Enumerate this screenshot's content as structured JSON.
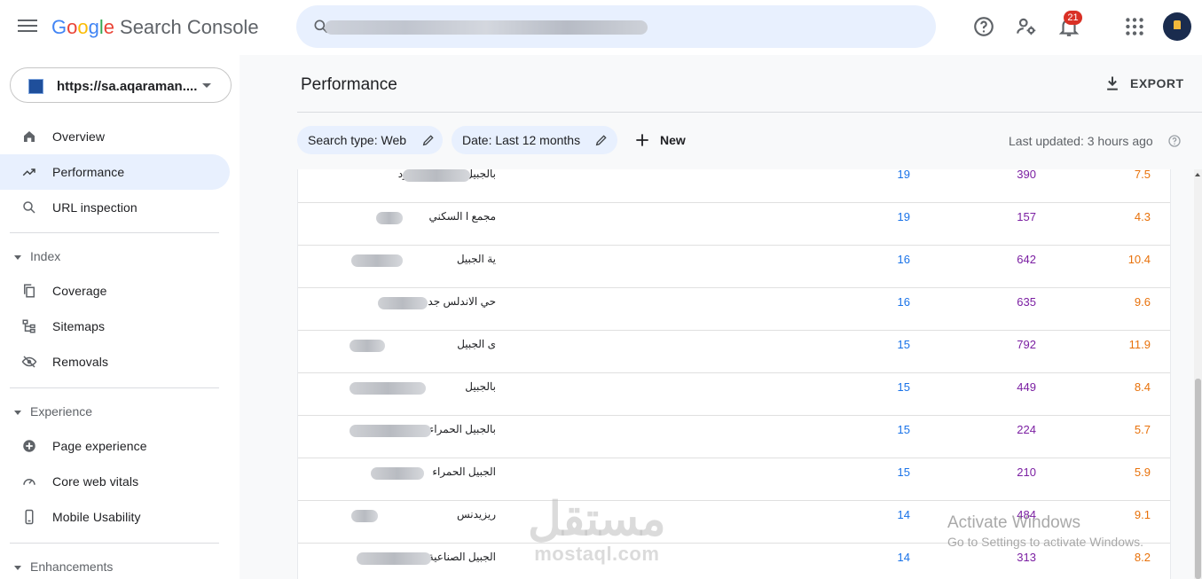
{
  "header": {
    "menu_icon": "hamburger-menu-icon",
    "logo": {
      "parts": [
        "G",
        "o",
        "o",
        "g",
        "l",
        "e"
      ],
      "product": "Search Console"
    },
    "search": {
      "placeholder": "",
      "icon": "search-icon"
    },
    "icons": {
      "help": "help-circle-icon",
      "settings": "manage-users-icon",
      "notifications": "bell-icon",
      "apps": "apps-grid-icon"
    },
    "notification_count": "21"
  },
  "sidebar": {
    "property": "https://sa.aqaraman....",
    "nav": [
      {
        "label": "Overview",
        "icon": "home-icon"
      },
      {
        "label": "Performance",
        "icon": "trending-up-icon",
        "active": true
      },
      {
        "label": "URL inspection",
        "icon": "search-icon"
      }
    ],
    "sections": [
      {
        "title": "Index",
        "items": [
          {
            "label": "Coverage",
            "icon": "copy-icon"
          },
          {
            "label": "Sitemaps",
            "icon": "sitemap-icon"
          },
          {
            "label": "Removals",
            "icon": "visibility-off-icon"
          }
        ]
      },
      {
        "title": "Experience",
        "items": [
          {
            "label": "Page experience",
            "icon": "plus-circle-icon"
          },
          {
            "label": "Core web vitals",
            "icon": "speed-gauge-icon"
          },
          {
            "label": "Mobile Usability",
            "icon": "phone-icon"
          }
        ]
      },
      {
        "title": "Enhancements",
        "items": []
      }
    ]
  },
  "main": {
    "title": "Performance",
    "export_label": "EXPORT",
    "filters": [
      {
        "label": "Search type: Web"
      },
      {
        "label": "Date: Last 12 months"
      }
    ],
    "new_label": "New",
    "last_updated": "Last updated: 3 hours ago",
    "rows": [
      {
        "query": "بالجبيل الدخل المحدود",
        "clicks": "19",
        "impressions": "390",
        "position": "7.5"
      },
      {
        "query": "مجمع ا السكني",
        "clicks": "19",
        "impressions": "157",
        "position": "4.3"
      },
      {
        "query": "ية الجبيل",
        "clicks": "16",
        "impressions": "642",
        "position": "10.4"
      },
      {
        "query": "حي الاندلس جده",
        "clicks": "16",
        "impressions": "635",
        "position": "9.6"
      },
      {
        "query": "ى الجبيل",
        "clicks": "15",
        "impressions": "792",
        "position": "11.9"
      },
      {
        "query": "بالجبيل",
        "clicks": "15",
        "impressions": "449",
        "position": "8.4"
      },
      {
        "query": "بالجبيل الحمراء",
        "clicks": "15",
        "impressions": "224",
        "position": "5.7"
      },
      {
        "query": "الجبيل الحمراء",
        "clicks": "15",
        "impressions": "210",
        "position": "5.9"
      },
      {
        "query": "ريزيدنس",
        "clicks": "14",
        "impressions": "484",
        "position": "9.1"
      },
      {
        "query": "الجبيل الصناعية",
        "clicks": "14",
        "impressions": "313",
        "position": "8.2"
      }
    ]
  },
  "overlay": {
    "watermark_ar": "مستقل",
    "watermark_latin": "mostaql.com",
    "activate_title": "Activate Windows",
    "activate_sub": "Go to Settings to activate Windows."
  },
  "colors": {
    "clicks": "#1a73e8",
    "impressions": "#7b1fa2",
    "position": "#e8710a",
    "active_nav": "#e8f0fe"
  }
}
